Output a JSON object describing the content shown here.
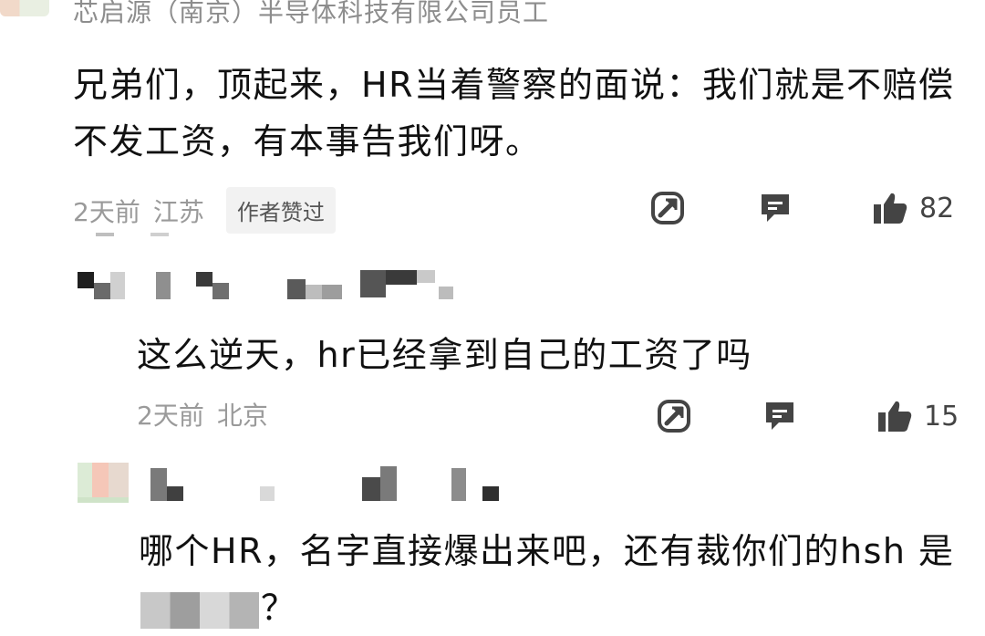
{
  "comments": [
    {
      "author": "芯启源（南京）半导体科技有限公司员工",
      "text": "兄弟们，顶起来，HR当着警察的面说：我们就是不赔偿 不发工资，有本事告我们呀。",
      "time": "2天前",
      "location": "江苏",
      "badge": "作者赞过",
      "likes": "82"
    },
    {
      "author": "",
      "text": "这么逆天，hr已经拿到自己的工资了吗",
      "time": "2天前",
      "location": "北京",
      "likes": "15"
    },
    {
      "author": "",
      "text_before": "哪个HR，名字直接爆出来吧，还有裁你们的hsh 是",
      "text_after": "？"
    }
  ],
  "icons": {
    "share": "share-icon",
    "reply": "comment-icon",
    "like": "thumbs-up-icon"
  },
  "colors": {
    "meta": "#9a9a9a",
    "badge_bg": "#f2f2f2",
    "text": "#111111"
  }
}
